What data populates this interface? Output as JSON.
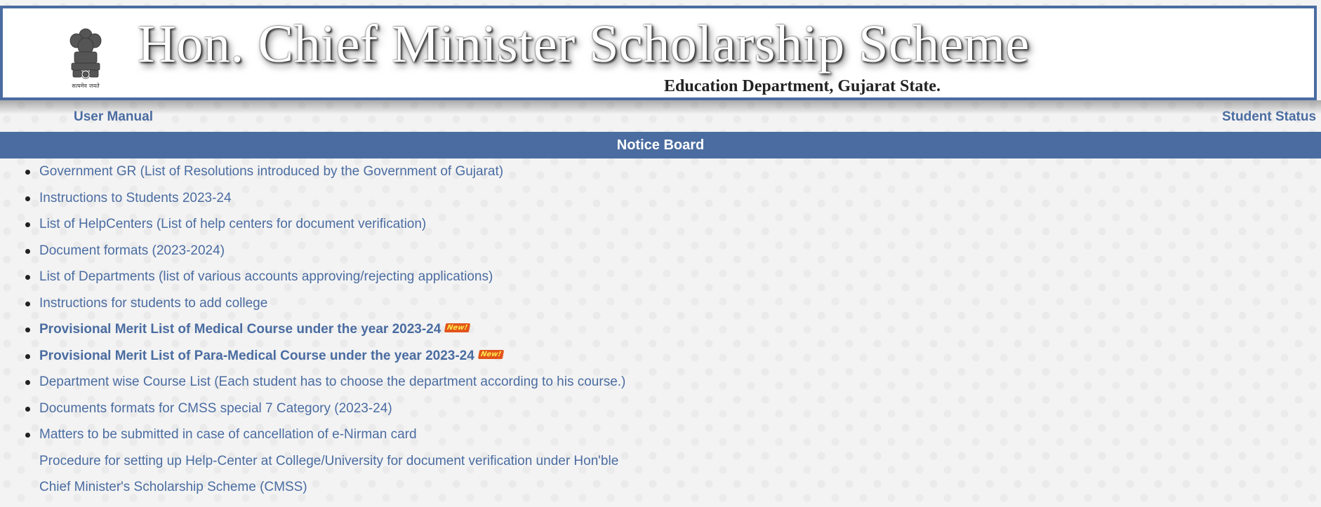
{
  "header": {
    "title": "Hon. Chief Minister Scholarship Scheme",
    "subtitle": "Education Department, Gujarat State.",
    "emblem_icon": "state-emblem-icon",
    "emblem_motto": "सत्यमेव जयते"
  },
  "nav": {
    "user_manual": "User Manual",
    "student_status": "Student Status"
  },
  "notice_board": {
    "heading": "Notice Board",
    "new_badge": "New!",
    "items": [
      {
        "text": "Government GR (List of Resolutions introduced by the Government of Gujarat)"
      },
      {
        "text": "Instructions to Students 2023-24"
      },
      {
        "text": "List of HelpCenters (List of help centers for document verification)"
      },
      {
        "text": "Document formats (2023-2024)"
      },
      {
        "text": "List of Departments (list of various accounts approving/rejecting applications)"
      },
      {
        "text": "Instructions for students to add college"
      },
      {
        "text": "Provisional Merit List of Medical Course under the year 2023-24"
      },
      {
        "text": "Provisional Merit List of Para-Medical Course under the year 2023-24"
      },
      {
        "text": "Department wise Course List (Each student has to choose the department according to his course.)"
      },
      {
        "text": "Documents formats for CMSS special 7 Category (2023-24)"
      },
      {
        "text": "Matters to be submitted in case of cancellation of e-Nirman card"
      },
      {
        "text": "Procedure for setting up Help-Center at College/University for document verification under Hon'ble"
      },
      {
        "text": "Chief Minister's Scholarship Scheme (CMSS)"
      }
    ]
  },
  "colors": {
    "accent": "#4a6ca1",
    "badge_bg": "#e2541b",
    "badge_text": "#ffe84d"
  }
}
